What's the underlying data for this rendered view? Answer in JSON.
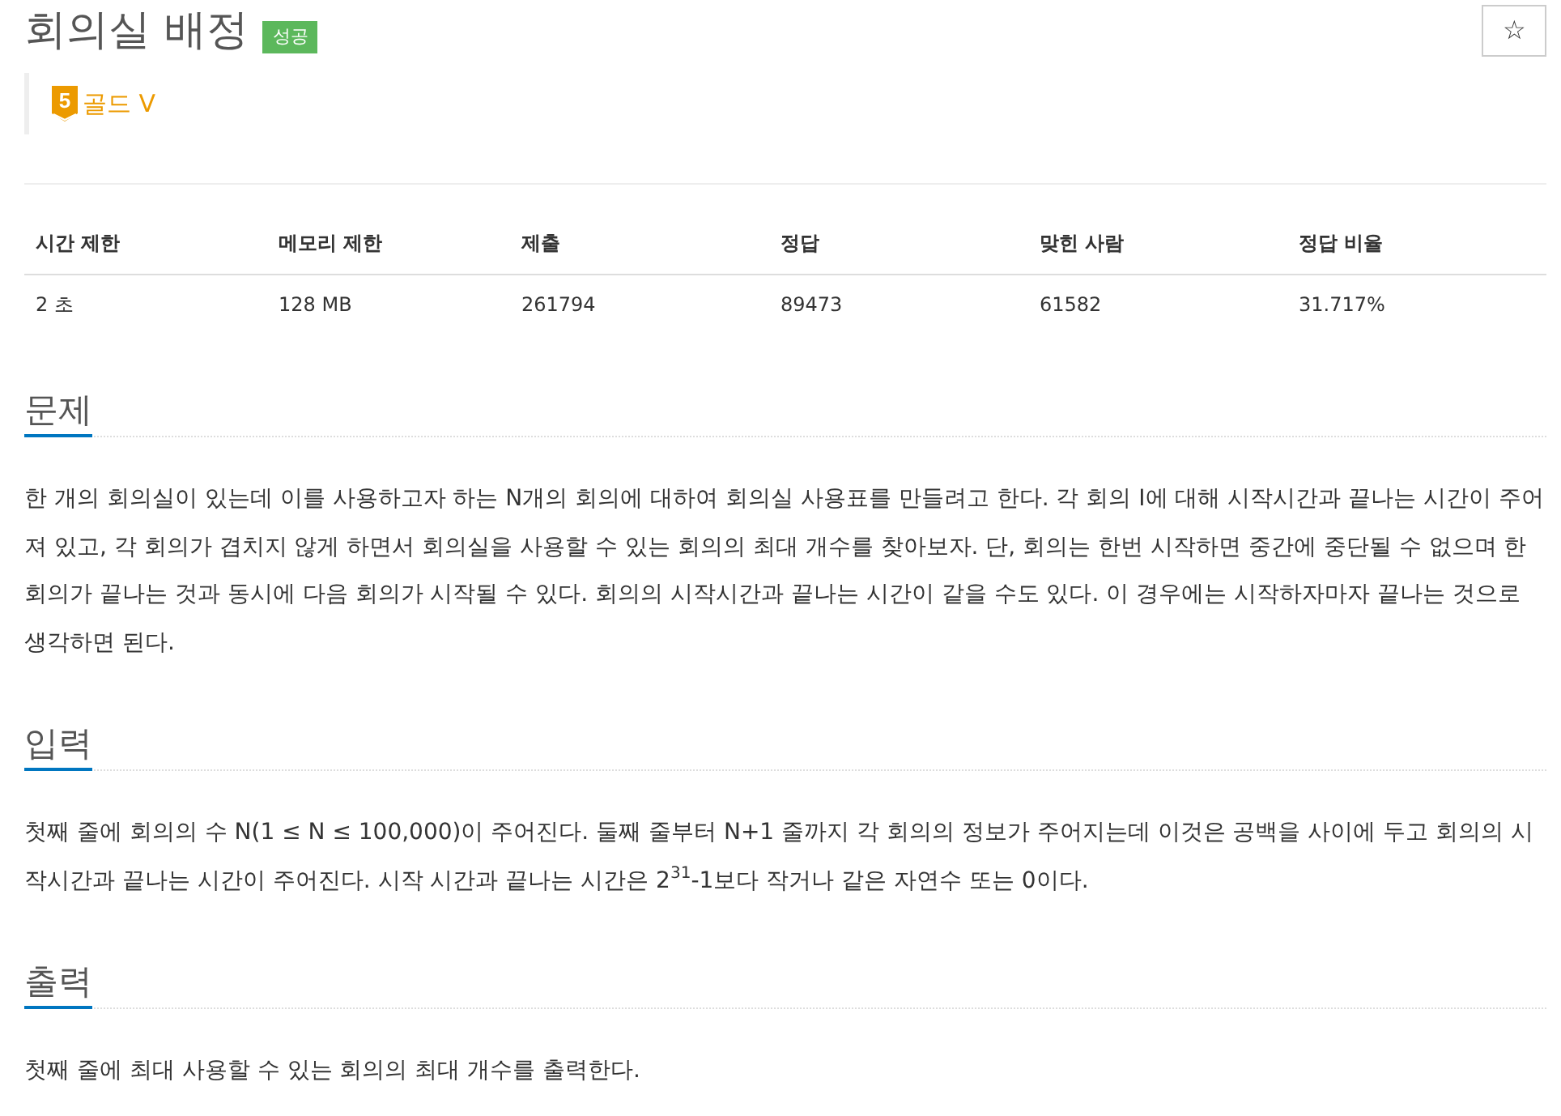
{
  "title": "회의실 배정",
  "result_badge": "성공",
  "star_button": "☆",
  "tier": {
    "number": "5",
    "label": "골드 V"
  },
  "stats": {
    "columns": [
      "시간 제한",
      "메모리 제한",
      "제출",
      "정답",
      "맞힌 사람",
      "정답 비율"
    ],
    "row": [
      "2 초",
      "128 MB",
      "261794",
      "89473",
      "61582",
      "31.717%"
    ]
  },
  "sections": [
    {
      "heading": "문제",
      "paragraphs": [
        "한 개의 회의실이 있는데 이를 사용하고자 하는 N개의 회의에 대하여 회의실 사용표를 만들려고 한다. 각 회의 I에 대해 시작시간과 끝나는 시간이 주어져 있고, 각 회의가 겹치지 않게 하면서 회의실을 사용할 수 있는 회의의 최대 개수를 찾아보자. 단, 회의는 한번 시작하면 중간에 중단될 수 없으며 한 회의가 끝나는 것과 동시에 다음 회의가 시작될 수 있다. 회의의 시작시간과 끝나는 시간이 같을 수도 있다. 이 경우에는 시작하자마자 끝나는 것으로 생각하면 된다."
      ]
    },
    {
      "heading": "입력",
      "paragraphs": [
        "첫째 줄에 회의의 수 N(1 ≤ N ≤ 100,000)이 주어진다. 둘째 줄부터 N+1 줄까지 각 회의의 정보가 주어지는데 이것은 공백을 사이에 두고 회의의 시작시간과 끝나는 시간이 주어진다. 시작 시간과 끝나는 시간은 2$^{31}$-1보다 작거나 같은 자연수 또는 0이다."
      ]
    },
    {
      "heading": "출력",
      "paragraphs": [
        "첫째 줄에 최대 사용할 수 있는 회의의 최대 개수를 출력한다."
      ]
    }
  ]
}
